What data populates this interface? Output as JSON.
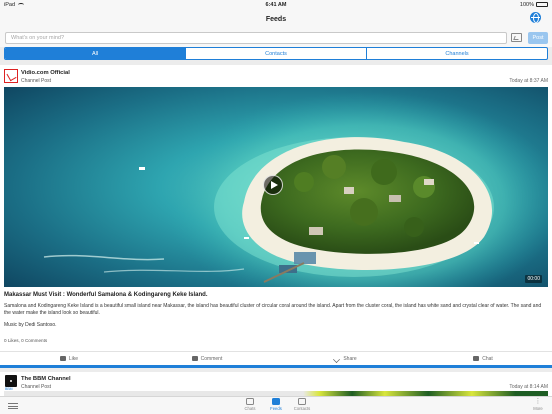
{
  "status_bar": {
    "device": "iPad",
    "time": "6:41 AM",
    "battery": "100%"
  },
  "header": {
    "title": "Feeds"
  },
  "composer": {
    "placeholder": "What's on your mind?",
    "post_label": "Post"
  },
  "tabs": [
    "All",
    "Contacts",
    "Channels"
  ],
  "posts": [
    {
      "channel": "Vidio.com Official",
      "type": "Channel Post",
      "time": "Today at 8:37 AM",
      "duration": "00:00",
      "headline": "Makassar Must Visit : Wonderful Samalona & Kodingareng Keke Island.",
      "body": "Samalona and Kodingareng Keke Island is a beautiful small island near Makassar, the island has beautiful cluster of circular coral around the island. Apart from the cluster coral, the island has white sand and crystal clear of water. The sand and the water make the island look so beautiful.",
      "credit": "Music by Dedi Santoso.",
      "stats": "0 Likes, 0 Comments",
      "actions": [
        "Like",
        "Comment",
        "Share",
        "Chat"
      ]
    },
    {
      "channel": "The BBM Channel",
      "type": "Channel Post",
      "time": "Today at 8:14 AM",
      "badge": "BBM"
    }
  ],
  "tab_bar": {
    "items": [
      "Chats",
      "Feeds",
      "Contacts"
    ],
    "more_label": "More",
    "active": "Feeds"
  },
  "colors": {
    "accent": "#1f7fd8",
    "background": "#ececec"
  }
}
